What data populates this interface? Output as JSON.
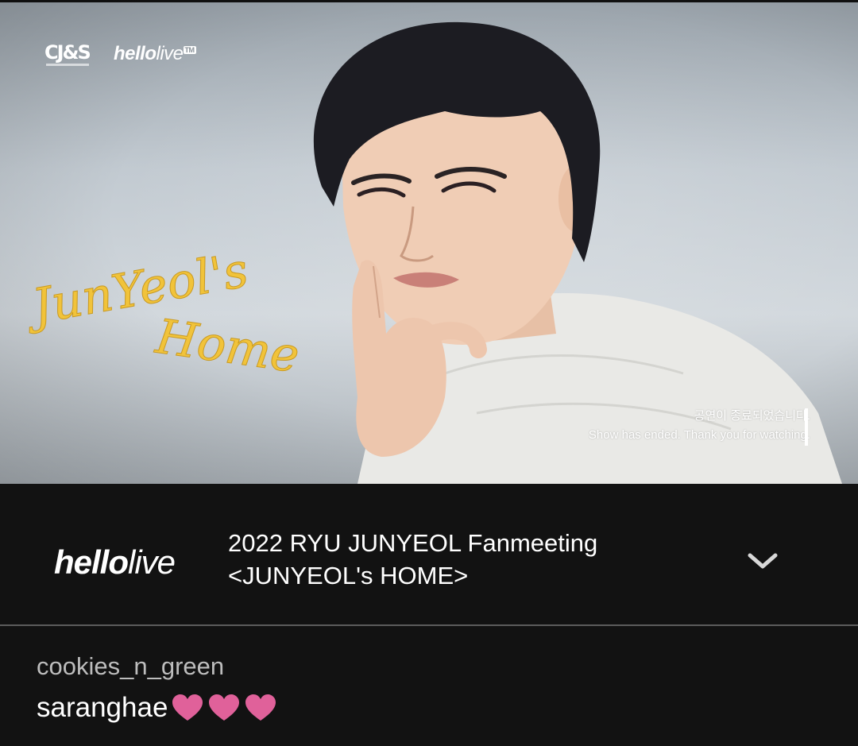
{
  "video": {
    "brand_cj": "CJ&S",
    "brand_hello_bold": "hello",
    "brand_hello_lite": "live",
    "brand_tag": "TM",
    "script_title_line1": "JunYeol's",
    "script_title_line2": "Home",
    "ended_korean": "공연이 종료되었습니다.",
    "ended_english": "Show has ended. Thank you for watching."
  },
  "info": {
    "brand_bold": "hello",
    "brand_lite": "live",
    "title_line1": "2022 RYU JUNYEOL Fanmeeting",
    "title_line2": "<JUNYEOL's HOME>"
  },
  "comment": {
    "username": "cookies_n_green",
    "text": "saranghae",
    "hearts": 3
  },
  "colors": {
    "background": "#121212",
    "heart": "#e0619a",
    "script_title": "#f1c33a",
    "username": "#bdbdbd"
  }
}
